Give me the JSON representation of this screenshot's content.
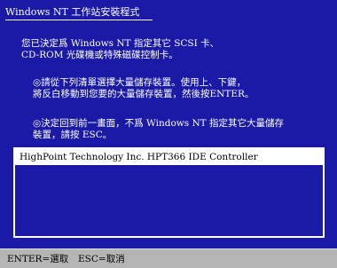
{
  "header": {
    "title": "Windows NT 工作站安裝程式"
  },
  "body": {
    "line1": "您已決定爲 Windows NT 指定其它 SCSI 卡、",
    "line2": "CD-ROM 光碟機或特殊磁碟控制卡。",
    "line3": "◎請從下列清單選擇大量儲存裝置。使用上、下鍵，",
    "line4": "將反白移動到您要的大量儲存裝置，然後按ENTER。",
    "line5": "◎決定回到前一畫面，不爲 Windows NT 指定其它大量儲存",
    "line6": "裝置，請按 ESC。"
  },
  "list": {
    "items": [
      "HighPoint Technology Inc. HPT366 IDE Controller"
    ],
    "selected_index": 0
  },
  "statusbar": {
    "enter_hint": "ENTER=選取",
    "esc_hint": "ESC=取消"
  },
  "colors": {
    "background": "#1a1aa6",
    "text": "#ffffff",
    "status_bg": "#b5b5b5",
    "selection_bg": "#ffffff",
    "selection_text": "#000000"
  }
}
